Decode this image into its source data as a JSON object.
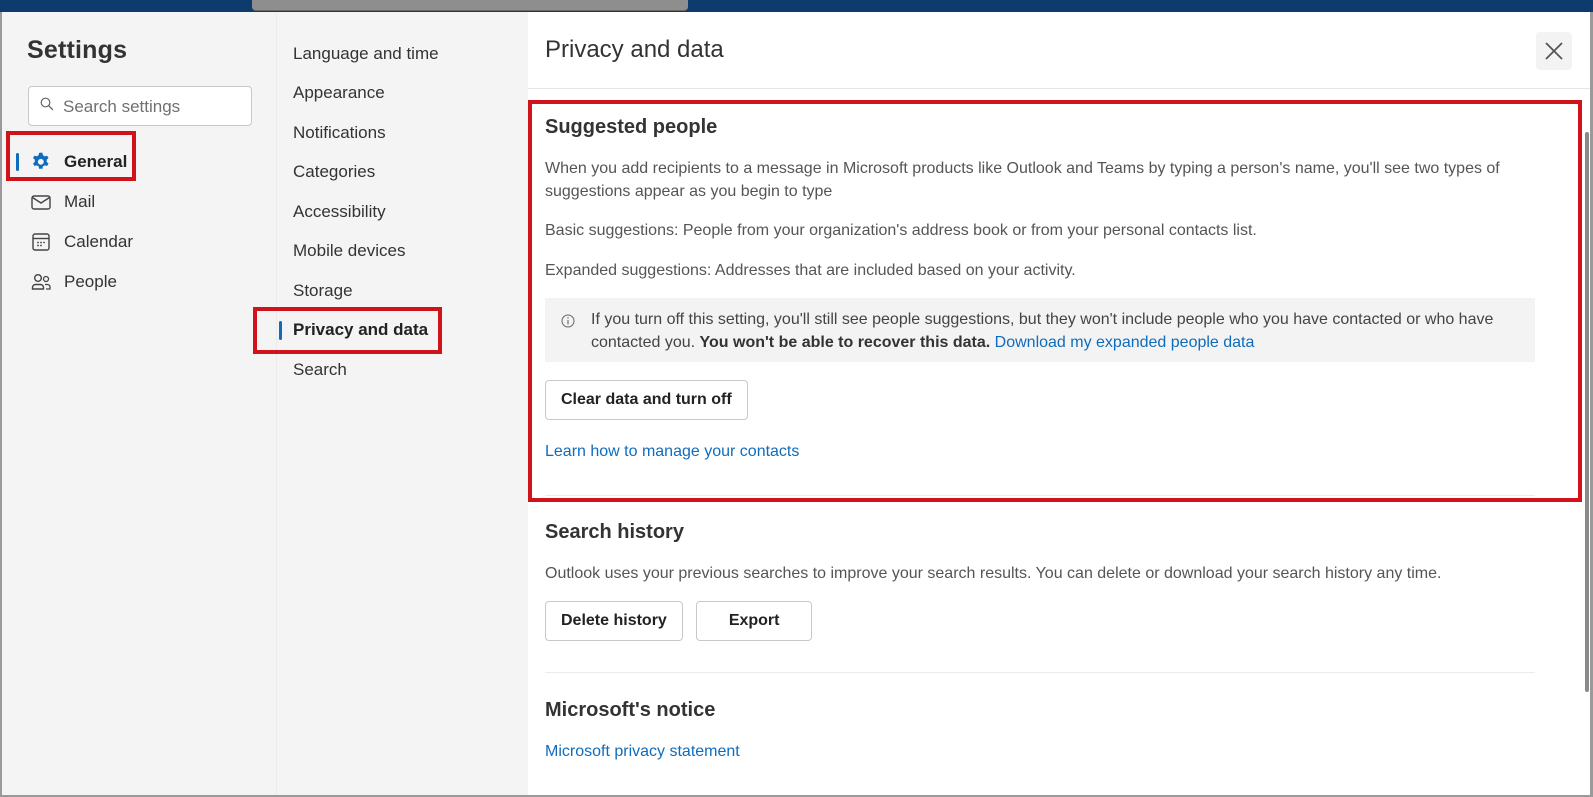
{
  "window": {
    "title": "Settings"
  },
  "search": {
    "placeholder": "Search settings",
    "value": ""
  },
  "primary_nav": {
    "items": [
      {
        "label": "General",
        "icon": "gear-icon",
        "active": true
      },
      {
        "label": "Mail",
        "icon": "mail-icon",
        "active": false
      },
      {
        "label": "Calendar",
        "icon": "calendar-icon",
        "active": false
      },
      {
        "label": "People",
        "icon": "people-icon",
        "active": false
      }
    ]
  },
  "secondary_nav": {
    "items": [
      {
        "label": "Language and time",
        "active": false
      },
      {
        "label": "Appearance",
        "active": false
      },
      {
        "label": "Notifications",
        "active": false
      },
      {
        "label": "Categories",
        "active": false
      },
      {
        "label": "Accessibility",
        "active": false
      },
      {
        "label": "Mobile devices",
        "active": false
      },
      {
        "label": "Storage",
        "active": false
      },
      {
        "label": "Privacy and data",
        "active": true
      },
      {
        "label": "Search",
        "active": false
      }
    ]
  },
  "page": {
    "title": "Privacy and data",
    "close_label": "Close"
  },
  "suggested_people": {
    "title": "Suggested people",
    "intro": "When you add recipients to a message in Microsoft products like Outlook and Teams by typing a person's name, you'll see two types of suggestions appear as you begin to type",
    "basic": "Basic suggestions: People from your organization's address book or from your personal contacts list.",
    "expanded": "Expanded suggestions: Addresses that are included based on your activity.",
    "info_text": "If you turn off this setting, you'll still see people suggestions, but they won't include people who you have contacted or who have contacted you.",
    "info_bold": "You won't be able to recover this data.",
    "info_link": "Download my expanded people data",
    "clear_button": "Clear data and turn off",
    "learn_link": "Learn how to manage your contacts"
  },
  "search_history": {
    "title": "Search history",
    "description": "Outlook uses your previous searches to improve your search results. You can delete or download your search history any time.",
    "delete_button": "Delete history",
    "export_button": "Export"
  },
  "notice": {
    "title": "Microsoft's notice",
    "privacy_link": "Microsoft privacy statement"
  },
  "colors": {
    "accent": "#0f6cbd",
    "highlight_box": "#d0121a",
    "top_bar": "#0d3b6e"
  }
}
